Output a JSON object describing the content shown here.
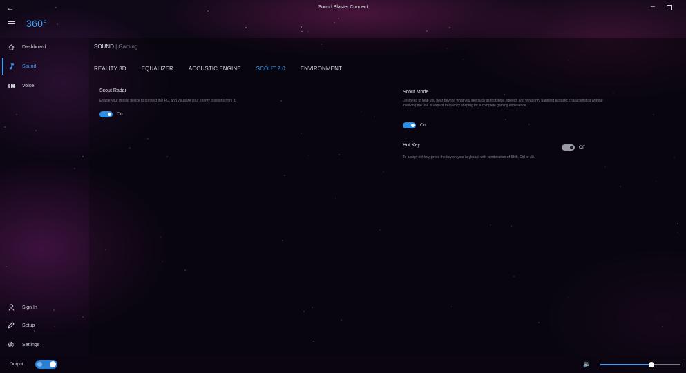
{
  "window": {
    "title": "Sound Blaster Connect"
  },
  "header": {
    "brand": "360°"
  },
  "sidebar": {
    "items": [
      {
        "label": "Dashboard",
        "icon": "home-icon",
        "active": false
      },
      {
        "label": "Sound",
        "icon": "music-note-icon",
        "active": true
      },
      {
        "label": "Voice",
        "icon": "voice-icon",
        "active": false
      }
    ],
    "bottom_items": [
      {
        "label": "Sign In",
        "icon": "user-icon"
      },
      {
        "label": "Setup",
        "icon": "pencil-icon"
      },
      {
        "label": "Settings",
        "icon": "gear-icon"
      }
    ]
  },
  "main": {
    "title": "SOUND",
    "subtitle": " | Gaming",
    "tabs": [
      {
        "label": "REALITY 3D",
        "active": false
      },
      {
        "label": "EQUALIZER",
        "active": false
      },
      {
        "label": "ACOUSTIC ENGINE",
        "active": false
      },
      {
        "label": "SCOUT 2.0",
        "active": true
      },
      {
        "label": "ENVIRONMENT",
        "active": false
      }
    ],
    "scout_radar": {
      "title": "Scout Radar",
      "description": "Enable your mobile device to connect this PC, and visualize your enemy positions from it.",
      "toggle_label": "On",
      "on": true
    },
    "scout_mode": {
      "title": "Scout Mode",
      "description": "Designed to help you hear beyond what you see such as footsteps, speech and weaponry handling acoustic characteristics without involving the use of explicit frequency shaping for a complete gaming experience.",
      "toggle_label": "On",
      "on": true
    },
    "hot_key": {
      "title": "Hot Key",
      "description": "To assign hot key, press the key on your keyboard with combination of Shift, Ctrl or Alt.",
      "toggle_label": "Off",
      "on": false
    }
  },
  "bottom_bar": {
    "output_label": "Output",
    "volume_level": 0.64
  },
  "colors": {
    "accent": "#3ea0f4",
    "toggle_on": "#2a8de6"
  }
}
